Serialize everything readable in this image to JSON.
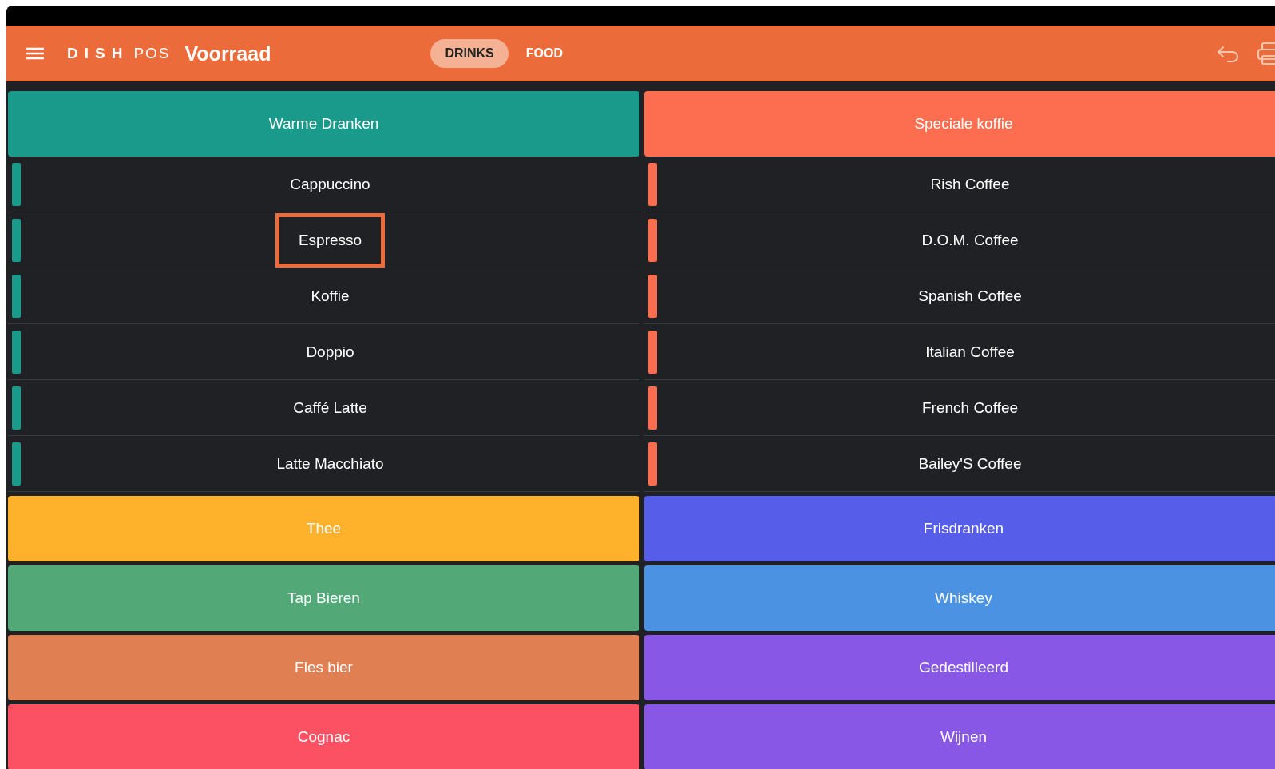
{
  "header": {
    "brand": {
      "name": "DISH",
      "suffix": "POS"
    },
    "title": "Voorraad",
    "tabs": [
      {
        "label": "DRINKS",
        "selected": true
      },
      {
        "label": "FOOD",
        "selected": false
      }
    ]
  },
  "columns": [
    [
      {
        "name": "Warme Dranken",
        "color": "#1a9a8b",
        "items": [
          {
            "name": "Cappuccino",
            "highlighted": false
          },
          {
            "name": "Espresso",
            "highlighted": true
          },
          {
            "name": "Koffie",
            "highlighted": false
          },
          {
            "name": "Doppio",
            "highlighted": false
          },
          {
            "name": "Caffé Latte",
            "highlighted": false
          },
          {
            "name": "Latte Macchiato",
            "highlighted": false
          }
        ]
      },
      {
        "name": "Thee",
        "color": "#feb12b"
      },
      {
        "name": "Tap Bieren",
        "color": "#52a977"
      },
      {
        "name": "Fles bier",
        "color": "#e07f52"
      },
      {
        "name": "Cognac",
        "color": "#fc5163"
      }
    ],
    [
      {
        "name": "Speciale koffie",
        "color": "#fd6e50",
        "items": [
          {
            "name": "Rish Coffee",
            "highlighted": false
          },
          {
            "name": "D.O.M. Coffee",
            "highlighted": false
          },
          {
            "name": "Spanish Coffee",
            "highlighted": false
          },
          {
            "name": "Italian Coffee",
            "highlighted": false
          },
          {
            "name": "French Coffee",
            "highlighted": false
          },
          {
            "name": "Bailey'S Coffee",
            "highlighted": false
          }
        ]
      },
      {
        "name": "Frisdranken",
        "color": "#565ee9"
      },
      {
        "name": "Whiskey",
        "color": "#4b93e2"
      },
      {
        "name": "Gedestilleerd",
        "color": "#8957e5"
      },
      {
        "name": "Wijnen",
        "color": "#8957e5"
      }
    ]
  ]
}
